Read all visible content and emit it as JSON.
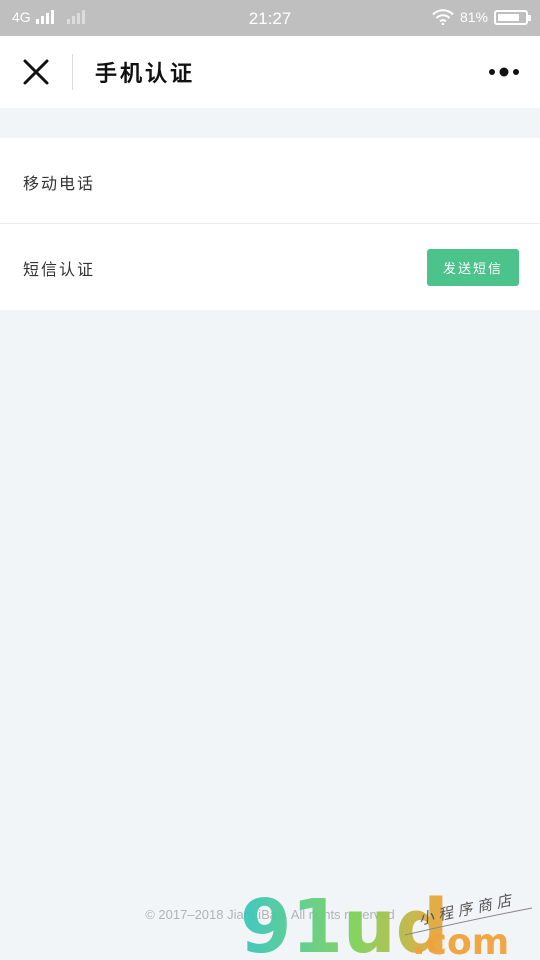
{
  "status_bar": {
    "network": "4G",
    "time": "21:27",
    "battery_percent": "81%",
    "battery_level": 0.81,
    "icons": [
      "signal-icon",
      "wifi-icon",
      "battery-icon"
    ]
  },
  "nav": {
    "title": "手机认证",
    "close_icon": "close-icon",
    "more_icon": "more-dots-icon"
  },
  "form": {
    "phone_label": "移动电话",
    "phone_value": "",
    "sms_label": "短信认证",
    "sms_value": "",
    "send_sms_button": "发送短信"
  },
  "footer": {
    "copyright": "© 2017–2018 JianLiBao. All rights reserved"
  },
  "watermark": {
    "logo_text": "91ud",
    "domain": ".com",
    "tagline": "小程序商店"
  },
  "colors": {
    "accent": "#4cc38a",
    "background": "#f2f5f7",
    "status_bar": "#bfbfbf"
  }
}
